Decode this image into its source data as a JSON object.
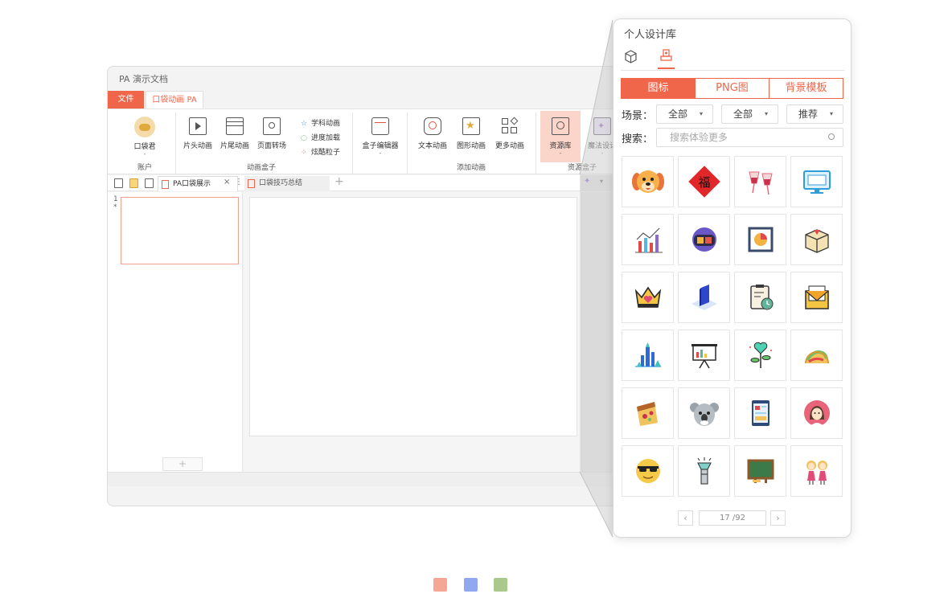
{
  "app": {
    "title": "PA 演示文档",
    "tabs": {
      "file": "文件",
      "pa": "口袋动画 PA"
    },
    "ribbon": {
      "account": {
        "label": "口袋君",
        "arrow": "-",
        "group": "账户"
      },
      "anim_box": {
        "head": "片头动画",
        "tail": "片尾动画",
        "page_turn": "页面转场",
        "subject": "学科动画",
        "progress": "进度加载",
        "particles": "炫酷粒子",
        "group": "动画盒子"
      },
      "box_editor": {
        "label": "盒子编辑器",
        "arrow": "-"
      },
      "add_anim": {
        "text": "文本动画",
        "shape": "图形动画",
        "more": "更多动画",
        "group": "添加动画"
      },
      "resources": {
        "library": "资源库",
        "library_arrow": "-",
        "magic": "魔法设计",
        "magic_arrow": "-",
        "group": "资源盒子"
      }
    },
    "doc_tabs": [
      {
        "name": "PA口袋展示",
        "active": true
      },
      {
        "name": "口袋技巧总结",
        "active": false
      }
    ],
    "slides": {
      "number": "1",
      "star": "*"
    },
    "add_slide": "+"
  },
  "panel": {
    "title": "个人设计库",
    "tabs": [
      "图标",
      "PNG图",
      "背景模板"
    ],
    "active_tab": "图标",
    "scene_label": "场景：",
    "filters": [
      "全部",
      "全部",
      "推荐"
    ],
    "search_label": "搜索：",
    "search_placeholder": "搜索体验更多",
    "icons": [
      "dog-face-icon",
      "fu-character-icon",
      "wine-glasses-icon",
      "computer-monitor-icon",
      "bar-chart-icon",
      "virtual-reality-icon",
      "pie-chart-board-icon",
      "gift-box-icon",
      "crown-heart-icon",
      "isometric-book-icon",
      "clipboard-clock-icon",
      "envelope-heart-icon",
      "city-skyline-icon",
      "presentation-board-icon",
      "heart-plant-icon",
      "taco-icon",
      "pizza-slice-icon",
      "koala-icon",
      "tablet-icon",
      "girl-avatar-icon",
      "cool-smiley-icon",
      "flashlight-icon",
      "blackboard-icon",
      "two-girls-icon"
    ],
    "pager": {
      "prev": "‹",
      "next": "›",
      "current": "17",
      "total": "/92"
    }
  },
  "colors": {
    "accent": "#f0664a",
    "dots": [
      "#f5a694",
      "#8fa8ef",
      "#a9c88b"
    ]
  }
}
